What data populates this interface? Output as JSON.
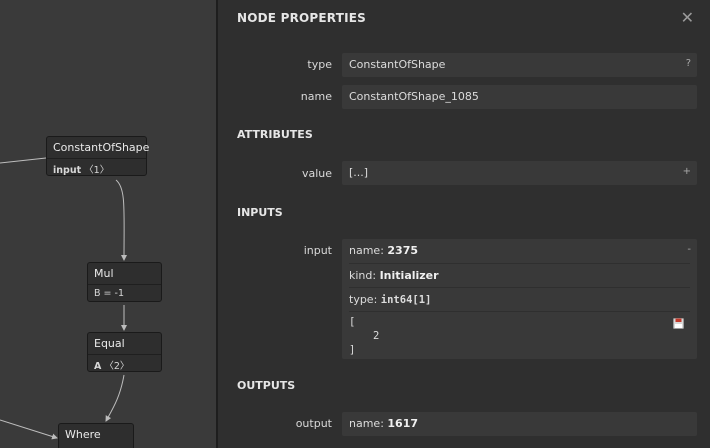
{
  "graph": {
    "nodes": [
      {
        "title": "ConstantOfShape",
        "attr_name": "input",
        "attr_value": "〈1〉"
      },
      {
        "title": "Mul",
        "attr_name": "",
        "attr_value": "B = -1"
      },
      {
        "title": "Equal",
        "attr_name": "A",
        "attr_value": "〈2〉"
      },
      {
        "title": "Where"
      }
    ]
  },
  "sidebar": {
    "title": "NODE PROPERTIES",
    "close_glyph": "✕",
    "type_label": "type",
    "type_value": "ConstantOfShape",
    "type_help": "?",
    "name_label": "name",
    "name_value": "ConstantOfShape_1085",
    "attributes_heading": "ATTRIBUTES",
    "value_label": "value",
    "value_value": "[...]",
    "value_expand": "+",
    "inputs_heading": "INPUTS",
    "input_label": "input",
    "input": {
      "name_key": "name: ",
      "name_val": "2375",
      "collapse": "-",
      "kind_key": "kind: ",
      "kind_val": "Initializer",
      "type_key": "type: ",
      "type_val": "int64[1]",
      "tensor_open": "[",
      "tensor_value": "2",
      "tensor_close": "]"
    },
    "outputs_heading": "OUTPUTS",
    "output_label": "output",
    "output": {
      "name_key": "name: ",
      "name_val": "1617"
    }
  }
}
